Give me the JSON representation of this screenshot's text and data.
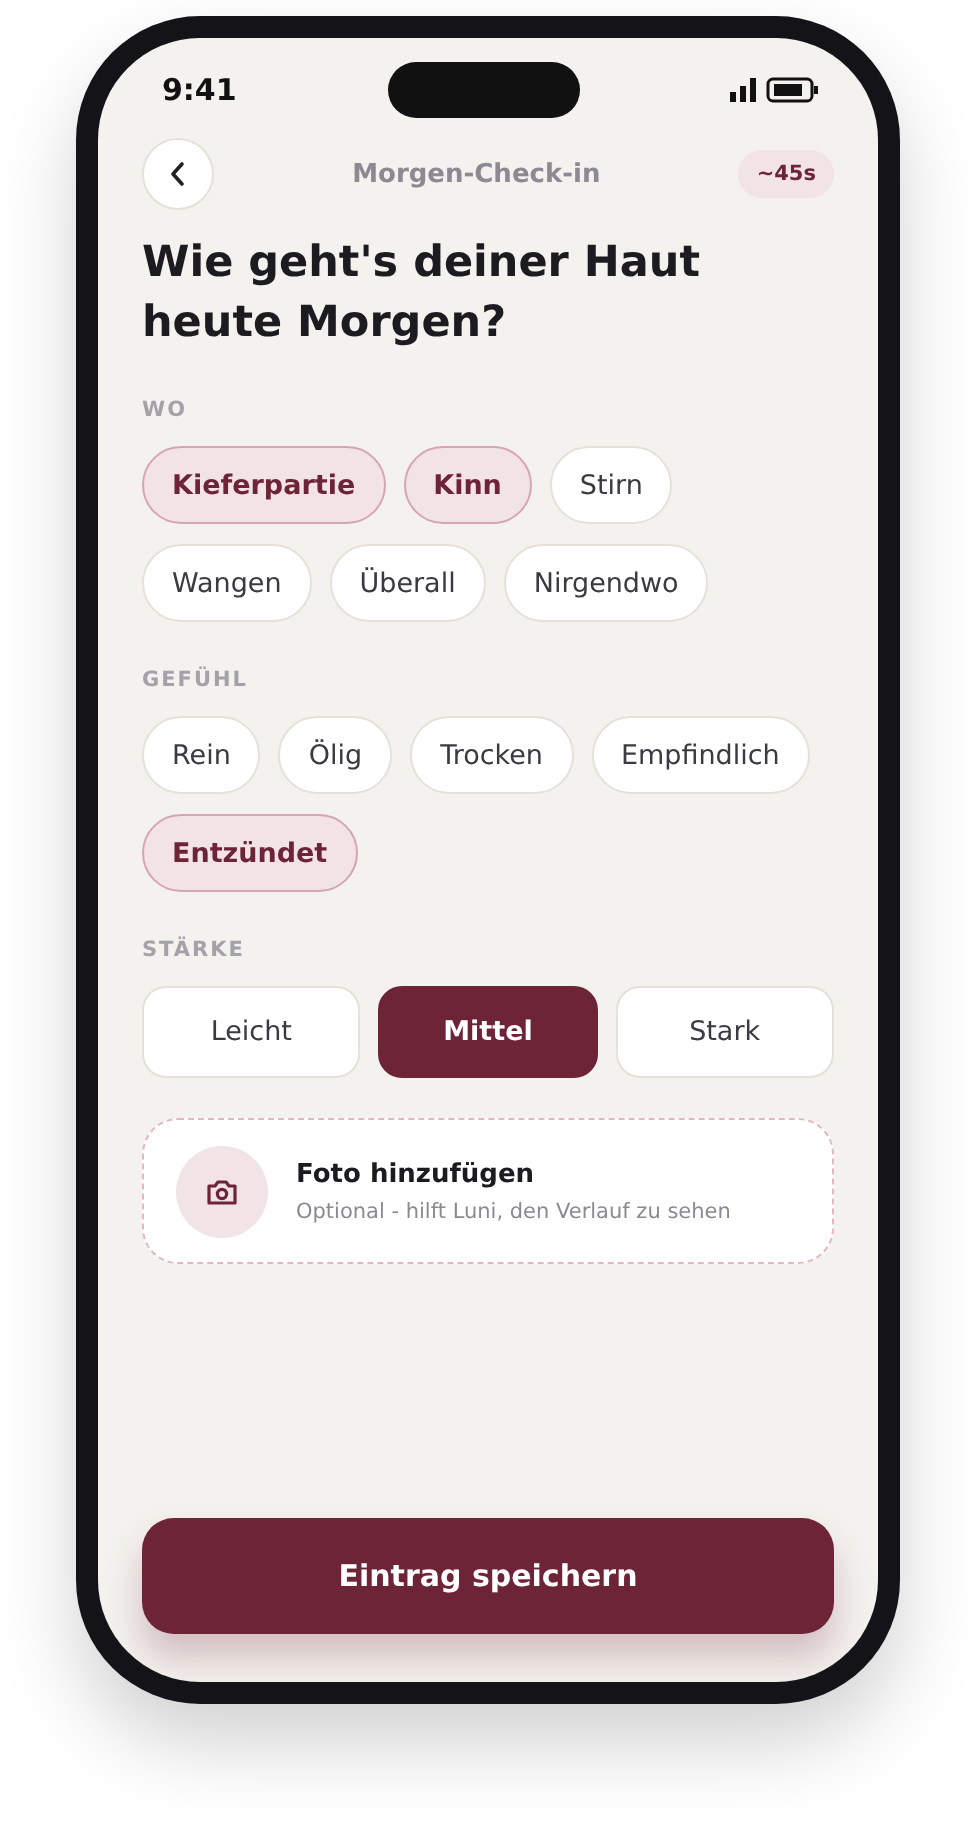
{
  "status_bar": {
    "time": "9:41"
  },
  "header": {
    "title": "Morgen-Check-in",
    "badge": "~45s"
  },
  "question": "Wie geht's deiner Haut heute Morgen?",
  "sections": [
    {
      "label": "WO",
      "chips": [
        {
          "label": "Kieferpartie",
          "selected": true
        },
        {
          "label": "Kinn",
          "selected": true
        },
        {
          "label": "Stirn",
          "selected": false
        },
        {
          "label": "Wangen",
          "selected": false
        },
        {
          "label": "Überall",
          "selected": false
        },
        {
          "label": "Nirgendwo",
          "selected": false
        }
      ]
    },
    {
      "label": "GEFÜHL",
      "chips": [
        {
          "label": "Rein",
          "selected": false
        },
        {
          "label": "Ölig",
          "selected": false
        },
        {
          "label": "Trocken",
          "selected": false
        },
        {
          "label": "Empfindlich",
          "selected": false
        },
        {
          "label": "Entzündet",
          "selected": true
        }
      ]
    }
  ],
  "intensity": {
    "label": "STÄRKE",
    "options": [
      {
        "label": "Leicht",
        "selected": false
      },
      {
        "label": "Mittel",
        "selected": true
      },
      {
        "label": "Stark",
        "selected": false
      }
    ]
  },
  "photo": {
    "title": "Foto hinzufügen",
    "subtitle": "Optional - hilft Luni, den Verlauf zu sehen"
  },
  "save_button": "Eintrag speichern"
}
